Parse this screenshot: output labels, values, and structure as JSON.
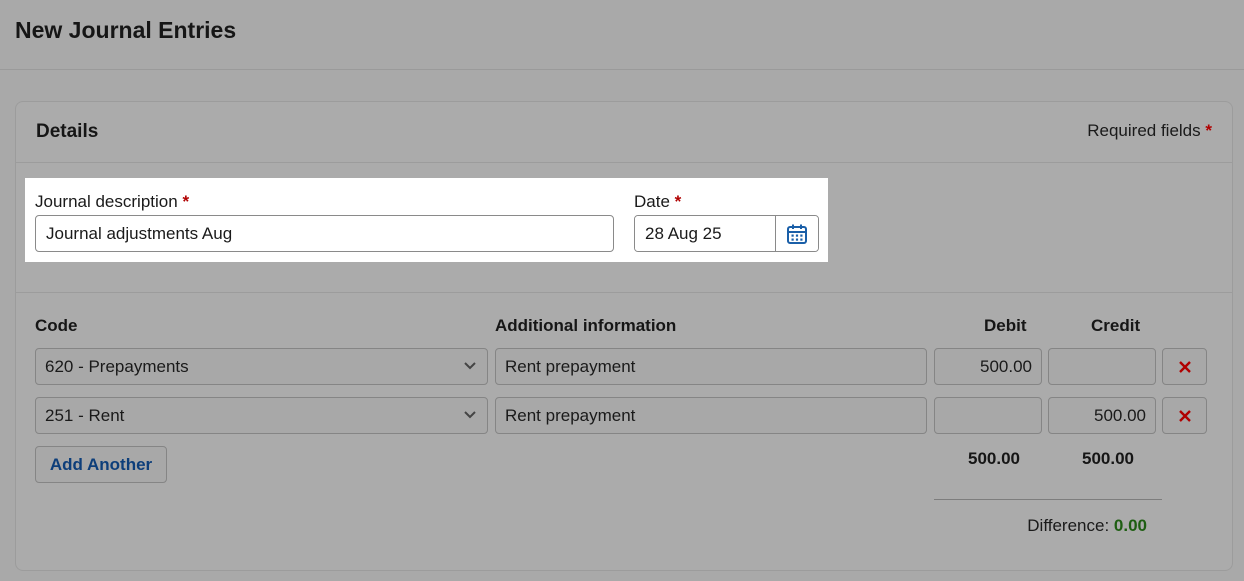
{
  "page": {
    "title": "New Journal Entries"
  },
  "details": {
    "title": "Details",
    "required_text": "Required fields",
    "required_star": "*"
  },
  "form": {
    "description_label": "Journal description",
    "description_value": "Journal adjustments Aug",
    "date_label": "Date",
    "date_value": "28 Aug 25"
  },
  "table": {
    "headers": {
      "code": "Code",
      "info": "Additional information",
      "debit": "Debit",
      "credit": "Credit"
    },
    "rows": [
      {
        "code": "620 - Prepayments",
        "info": "Rent prepayment",
        "debit": "500.00",
        "credit": ""
      },
      {
        "code": "251 - Rent",
        "info": "Rent prepayment",
        "debit": "",
        "credit": "500.00"
      }
    ],
    "add_label": "Add Another",
    "total_debit": "500.00",
    "total_credit": "500.00",
    "difference_label": "Difference:",
    "difference_value": "0.00"
  },
  "colors": {
    "accent": "#0d3e7a",
    "required": "#b00000",
    "delete": "#b00000",
    "difference": "#1e5e12"
  },
  "icons": {
    "calendar": "calendar-icon",
    "dropdown": "chevron-down-icon",
    "delete": "close-icon"
  }
}
